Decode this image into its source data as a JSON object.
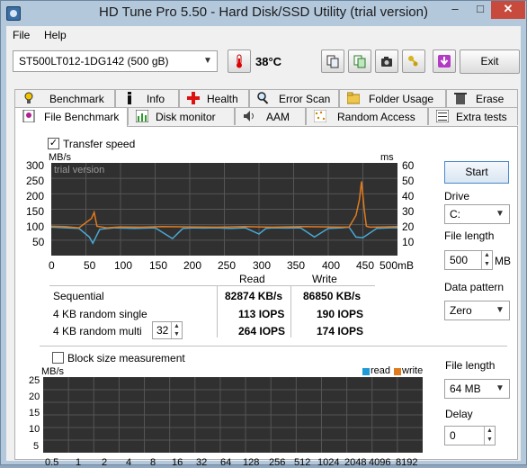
{
  "window": {
    "title": "HD Tune Pro 5.50 - Hard Disk/SSD Utility (trial version)"
  },
  "menu": {
    "file": "File",
    "help": "Help"
  },
  "toolbar": {
    "drive": "ST500LT012-1DG142 (500 gB)",
    "temperature": "38°C",
    "exit": "Exit",
    "icons": [
      "thermometer-icon",
      "copy-icon",
      "copy-all-icon",
      "camera-icon",
      "keys-icon",
      "download-icon"
    ]
  },
  "tabs_top": [
    "Benchmark",
    "Info",
    "Health",
    "Error Scan",
    "Folder Usage",
    "Erase"
  ],
  "tabs_bottom": [
    "File Benchmark",
    "Disk monitor",
    "AAM",
    "Random Access",
    "Extra tests"
  ],
  "transfer": {
    "checkbox_label": "Transfer speed",
    "checked": true,
    "unit_left": "MB/s",
    "unit_right": "ms",
    "watermark": "trial version",
    "y_left_ticks": [
      "300",
      "250",
      "200",
      "150",
      "100",
      "50"
    ],
    "y_right_ticks": [
      "60",
      "50",
      "40",
      "30",
      "20",
      "10"
    ],
    "x_ticks": [
      "0",
      "50",
      "100",
      "150",
      "200",
      "250",
      "300",
      "350",
      "400",
      "450",
      "500mB"
    ]
  },
  "results": {
    "col_read": "Read",
    "col_write": "Write",
    "rows": [
      {
        "label": "Sequential",
        "read": "82874 KB/s",
        "write": "86850 KB/s"
      },
      {
        "label": "4 KB random single",
        "read": "113 IOPS",
        "write": "190 IOPS"
      },
      {
        "label": "4 KB random multi",
        "read": "264 IOPS",
        "write": "174 IOPS"
      }
    ],
    "multi_value": "32"
  },
  "side": {
    "start": "Start",
    "drive_label": "Drive",
    "drive_value": "C:",
    "file_length_label": "File length",
    "file_length_value": "500",
    "file_length_unit": "MB",
    "data_pattern_label": "Data pattern",
    "data_pattern_value": "Zero",
    "file_length2_label": "File length",
    "file_length2_value": "64 MB",
    "delay_label": "Delay",
    "delay_value": "0"
  },
  "block": {
    "checkbox_label": "Block size measurement",
    "checked": false,
    "unit": "MB/s",
    "legend_read": "read",
    "legend_write": "write",
    "y_ticks": [
      "25",
      "20",
      "15",
      "10",
      "5"
    ],
    "x_ticks": [
      "0.5",
      "1",
      "2",
      "4",
      "8",
      "16",
      "32",
      "64",
      "128",
      "256",
      "512",
      "1024",
      "2048",
      "4096",
      "8192"
    ]
  },
  "chart_data": {
    "type": "line",
    "title": "",
    "xlabel": "",
    "ylabel": "MB/s",
    "y2label": "ms",
    "xlim": [
      0,
      500
    ],
    "ylim": [
      0,
      300
    ],
    "y2lim": [
      0,
      60
    ],
    "series": [
      {
        "name": "read",
        "color": "#4aa9d6",
        "axis": "left",
        "x": [
          0,
          20,
          40,
          55,
          60,
          70,
          90,
          120,
          150,
          175,
          190,
          205,
          220,
          240,
          260,
          280,
          300,
          310,
          320,
          340,
          360,
          380,
          400,
          420,
          430,
          440,
          450,
          470,
          490,
          500
        ],
        "y": [
          92,
          90,
          88,
          60,
          40,
          85,
          90,
          88,
          90,
          55,
          88,
          90,
          89,
          90,
          88,
          90,
          70,
          88,
          90,
          89,
          90,
          60,
          88,
          90,
          92,
          60,
          58,
          88,
          90,
          90
        ]
      },
      {
        "name": "write",
        "color": "#e07a1f",
        "axis": "left",
        "x": [
          0,
          20,
          40,
          58,
          62,
          66,
          80,
          100,
          130,
          160,
          200,
          240,
          280,
          300,
          320,
          360,
          400,
          430,
          440,
          445,
          448,
          452,
          455,
          460,
          480,
          500
        ],
        "y": [
          95,
          94,
          90,
          120,
          140,
          95,
          90,
          93,
          92,
          94,
          93,
          92,
          94,
          93,
          92,
          94,
          93,
          92,
          130,
          180,
          240,
          150,
          95,
          92,
          93,
          94
        ]
      }
    ]
  }
}
